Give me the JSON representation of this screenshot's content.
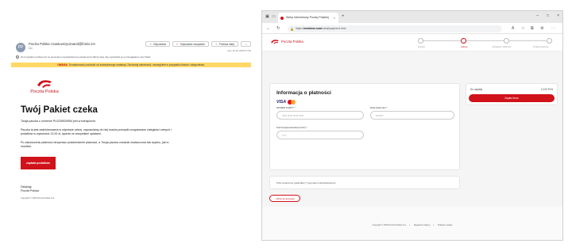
{
  "email": {
    "avatar_initials": "PP",
    "sender": "Poczta Polska <oantuvezyoznand@fomio.in>",
    "sender_to": "Do:",
    "actions": [
      "Odpowiedz",
      "Odpowiedz wszystkim",
      "Przekaż dalej"
    ],
    "more": "⋯",
    "date": "czw. 16.10.2025 07:52",
    "info": "W przypadku problemów ze sposobem wyświetlania tej wiadomości kliknij tutaj, aby wyświetlić ją w przeglądarce sieci Web.",
    "warning_strong": "UWAGA:",
    "warning": "Ta wiadomość pochodzi od zewnętrznego nadawcy. Zachowaj ostrożność, szczególnie w przypadku linków i załączników.",
    "logo_text": "Poczta Polska",
    "title": "Twój Pakiet czeka",
    "paragraphs": [
      "Twoja paczka o numerze PL0235529084 jest w transporcie.",
      "Paczka ta jest zadeklarowana w odprawie celnej, naprawiamy do niej koszta przesyłki uregulowane zaległości celnych i podatków w wysokości 12,00 zł, łącznie ze wszystkimi opłatami.",
      "Po zakończeniu płatności otrzymasz potwierdzenie płatności, a Twoja paczka zostanie dostarczona tak szybko, jak to możliwe."
    ],
    "pay_button": "zapłata podatków",
    "signoff": [
      "Dziękuję",
      "Poczta Polska"
    ],
    "copyright": "Copyright © 2025 Poczta Polska S.A."
  },
  "browser": {
    "tab_title": "Sklep Internetowy Poczty Polskiej",
    "tab_close": "×",
    "new_tab": "+",
    "window_controls": [
      "–",
      "□",
      "×"
    ],
    "url_prefix": "https://",
    "url_domain": "envirmse.com",
    "url_path": "/ochal/payment.html",
    "site_logo_text": "Poczta Polska",
    "steps": [
      {
        "label": "Koszyk",
        "active": false
      },
      {
        "label": "Adresy",
        "active": true
      },
      {
        "label": "Dostawa i płatność",
        "active": false
      },
      {
        "label": "Podsumowanie",
        "active": false
      }
    ],
    "payment_title": "Informacja o płatności",
    "card_number_label": "NUMER KARTY *",
    "card_number_placeholder": "0000 0000 0000 0000",
    "expiry_label": "Data ważności *",
    "expiry_placeholder": "MM/RR",
    "cvv_label": "Kod bezpieczeństwa (CVV) *",
    "cvv_placeholder": "CVV",
    "visa": "VISA",
    "required_note": "Pola oznaczone gwiazdką (*) są polami obowiązkowymi.",
    "back_button": "‹  Wróć do koszyka",
    "summary_label": "Do zapłaty",
    "summary_value": "12,00 PLN",
    "summary_button": "Zapłać teraz",
    "footer_items": [
      "Copyright © 2025 Poczta Polska S.A.",
      "Regulamin sklepu",
      "Polityka cookies"
    ]
  }
}
